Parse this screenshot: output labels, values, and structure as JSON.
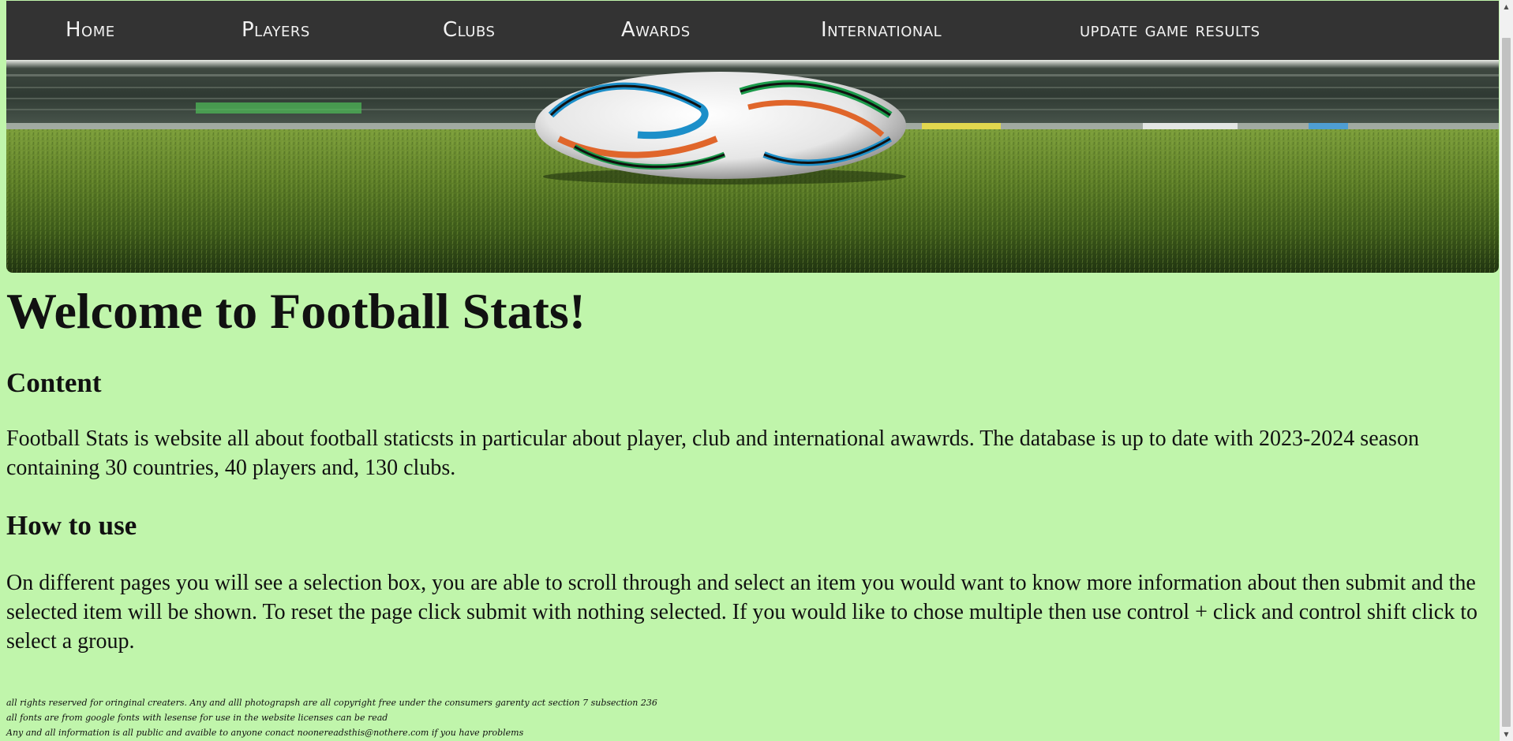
{
  "nav": {
    "items": [
      {
        "label": "Home"
      },
      {
        "label": "Players"
      },
      {
        "label": "Clubs"
      },
      {
        "label": "Awards"
      },
      {
        "label": "International"
      },
      {
        "label": "update game results"
      }
    ]
  },
  "hero": {
    "description_icon": "football-on-pitch-image"
  },
  "main": {
    "title": "Welcome to Football Stats!",
    "content_heading": "Content",
    "content_text": "Football Stats is website all about football staticsts in particular about player, club and international awawrds. The database is up to date with 2023-2024 season containing 30 countries, 40 players and, 130 clubs.",
    "howto_heading": "How to use",
    "howto_text": "On different pages you will see a selection box, you are able to scroll through and select an item you would want to know more information about then submit and the selected item will be shown. To reset the page click submit with nothing selected. If you would like to chose multiple then use control + click and control shift click to select a group."
  },
  "footer": {
    "lines": [
      "all rights reserved for oringinal creaters. Any and alll photograpsh are all copyright free under the consumers garenty act section 7 subsection 236",
      "all fonts are from google fonts with lesense for use in the website licenses can be read",
      "Any and all information is all public and avaible to anyone conact noonereadsthis@nothere.com if you have problems"
    ]
  },
  "colors": {
    "background": "#c0f5ab",
    "nav_background": "#333333",
    "nav_text": "#f2f2f2"
  }
}
